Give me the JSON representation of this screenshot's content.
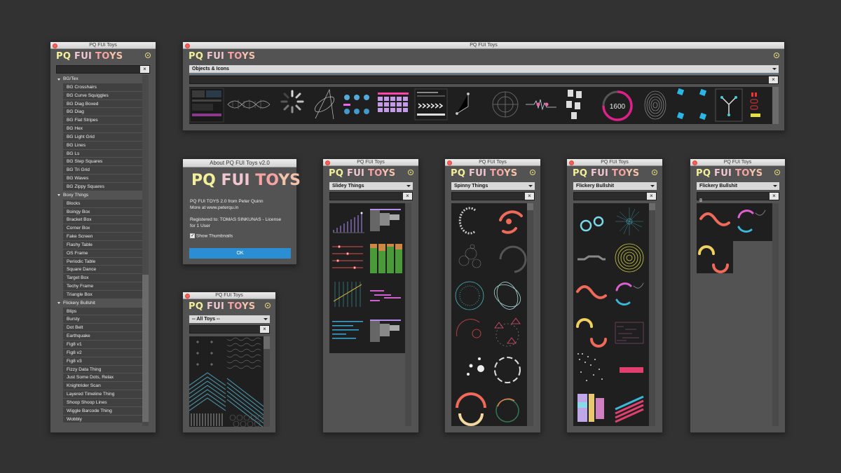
{
  "logo": {
    "p1": "PQ",
    "p2": "FUI",
    "p3": "TO",
    "p4": "YS"
  },
  "win_main": {
    "title": "PQ FUI Toys"
  },
  "win_objects": {
    "title": "PQ FUI Toys",
    "selected": "Objects & Icons",
    "counter": "1600"
  },
  "win_slidey": {
    "title": "PQ FUI Toys",
    "selected": "Slidey Things"
  },
  "win_spinny": {
    "title": "PQ FUI Toys",
    "selected": "Spinny Things"
  },
  "win_flickery": {
    "title": "PQ FUI Toys",
    "selected": "Flickery Bullshit"
  },
  "win_flickery2": {
    "title": "PQ FUI Toys",
    "selected": "Flickery Bullshit",
    "search_value": "8"
  },
  "win_alltoys": {
    "title": "PQ FUI Toys",
    "selected": "-- All Toys --"
  },
  "about": {
    "title": "About PQ FUI Toys v2.0",
    "line1": "PQ FUI TOYS 2.0 from Peter Quinn",
    "line2": "More at www.peterqu.in",
    "line3": "Registered to: TOMAS SINKUNAS  - License",
    "line4": "for 1 User",
    "checkbox_label": "Show Thumbnails",
    "ok": "OK"
  },
  "tree": [
    {
      "label": "BG/Tex",
      "group": true
    },
    {
      "label": "BG Crosshairs"
    },
    {
      "label": "BG Curve Squiggles"
    },
    {
      "label": "BG Diag Boxed"
    },
    {
      "label": "BG Diag"
    },
    {
      "label": "BG Flat Stripes"
    },
    {
      "label": "BG Hex"
    },
    {
      "label": "BG Light Grid"
    },
    {
      "label": "BG Lines"
    },
    {
      "label": "BG Ls"
    },
    {
      "label": "BG Step Squares"
    },
    {
      "label": "BG Tri Grid"
    },
    {
      "label": "BG Waves"
    },
    {
      "label": "BG Zippy Squares"
    },
    {
      "label": "Boxy Things",
      "group": true
    },
    {
      "label": "Blocks"
    },
    {
      "label": "Boingy Box"
    },
    {
      "label": "Bracket Box"
    },
    {
      "label": "Corner Box"
    },
    {
      "label": "Fake Screen"
    },
    {
      "label": "Flashy Table"
    },
    {
      "label": "OS Frame"
    },
    {
      "label": "Periodic Table"
    },
    {
      "label": "Square Dance"
    },
    {
      "label": "Target Box"
    },
    {
      "label": "Techy Frame"
    },
    {
      "label": "Triangle Box"
    },
    {
      "label": "Flickery Bullshit",
      "group": true
    },
    {
      "label": "Blips"
    },
    {
      "label": "Bursty"
    },
    {
      "label": "Dot Belt"
    },
    {
      "label": "Earthquake"
    },
    {
      "label": "Fig8 v1"
    },
    {
      "label": "Fig8 v2"
    },
    {
      "label": "Fig8 v3"
    },
    {
      "label": "Fizzy Data Thing"
    },
    {
      "label": "Just Some Dots, Relax"
    },
    {
      "label": "Knightrider Scan"
    },
    {
      "label": "Layered Timeline Thing"
    },
    {
      "label": "Shoop Shoop Lines"
    },
    {
      "label": "Wiggle Barcode Thing"
    },
    {
      "label": "Wobbly"
    }
  ]
}
